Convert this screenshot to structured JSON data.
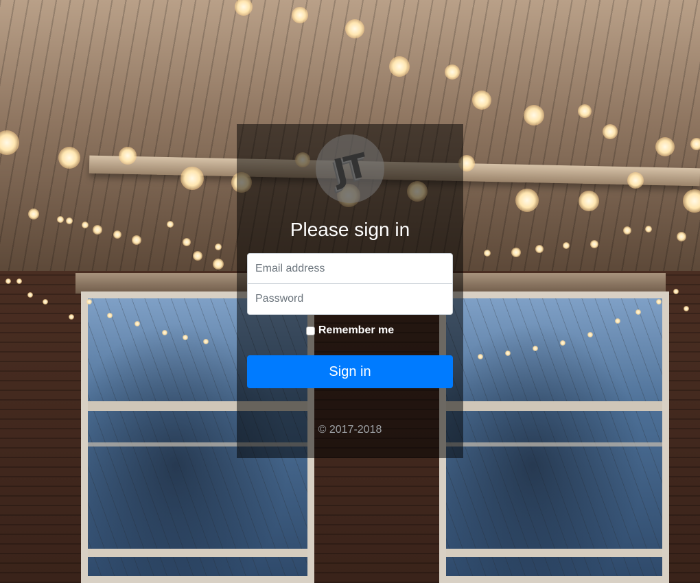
{
  "logo": {
    "text": "JT"
  },
  "form": {
    "title": "Please sign in",
    "email_placeholder": "Email address",
    "password_placeholder": "Password",
    "remember_label": "Remember me",
    "remember_checked": false,
    "submit_label": "Sign in"
  },
  "footer": {
    "copyright": "© 2017-2018"
  },
  "colors": {
    "primary_button": "#007bff",
    "card_overlay": "rgba(0,0,0,0.5)",
    "footer_text": "#a0a4a8"
  }
}
